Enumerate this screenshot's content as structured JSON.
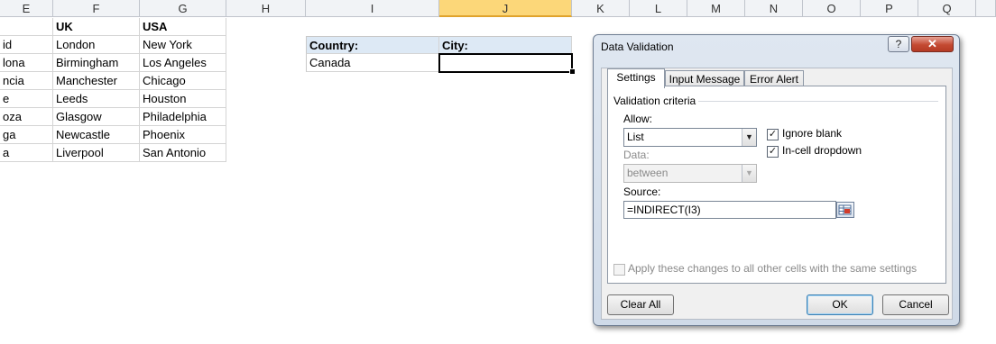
{
  "columns": [
    "E",
    "F",
    "G",
    "H",
    "I",
    "J",
    "K",
    "L",
    "M",
    "N",
    "O",
    "P",
    "Q"
  ],
  "selected_column": "J",
  "sheet": {
    "headers": [
      "",
      "UK",
      "USA"
    ],
    "rows": [
      [
        "id",
        "London",
        "New York"
      ],
      [
        "lona",
        "Birmingham",
        "Los Angeles"
      ],
      [
        "ncia",
        "Manchester",
        "Chicago"
      ],
      [
        "e",
        "Leeds",
        "Houston"
      ],
      [
        "oza",
        "Glasgow",
        "Philadelphia"
      ],
      [
        "ga",
        "Newcastle",
        "Phoenix"
      ],
      [
        "a",
        "Liverpool",
        "San Antonio"
      ]
    ],
    "country_label": "Country:",
    "city_label": "City:",
    "country_value": "Canada",
    "city_value": ""
  },
  "dialog": {
    "title": "Data Validation",
    "help": "?",
    "close": "✕",
    "tabs": [
      "Settings",
      "Input Message",
      "Error Alert"
    ],
    "active_tab": "Settings",
    "validation_criteria": "Validation criteria",
    "allow_label": "Allow:",
    "allow_value": "List",
    "data_label": "Data:",
    "data_value": "between",
    "ignore_blank": {
      "label": "Ignore blank",
      "checked": true
    },
    "in_cell_dropdown": {
      "label": "In-cell dropdown",
      "checked": true
    },
    "source_label": "Source:",
    "source_value": "=INDIRECT(I3)",
    "apply_all": {
      "label": "Apply these changes to all other cells with the same settings",
      "checked": false
    },
    "buttons": {
      "clear_all": "Clear All",
      "ok": "OK",
      "cancel": "Cancel"
    }
  },
  "colors": {
    "selected_column": "#fcd779",
    "header_fill": "#dde9f5",
    "close_button": "#c44a32"
  },
  "icons": {
    "check": "✓",
    "dropdown": "▼"
  }
}
